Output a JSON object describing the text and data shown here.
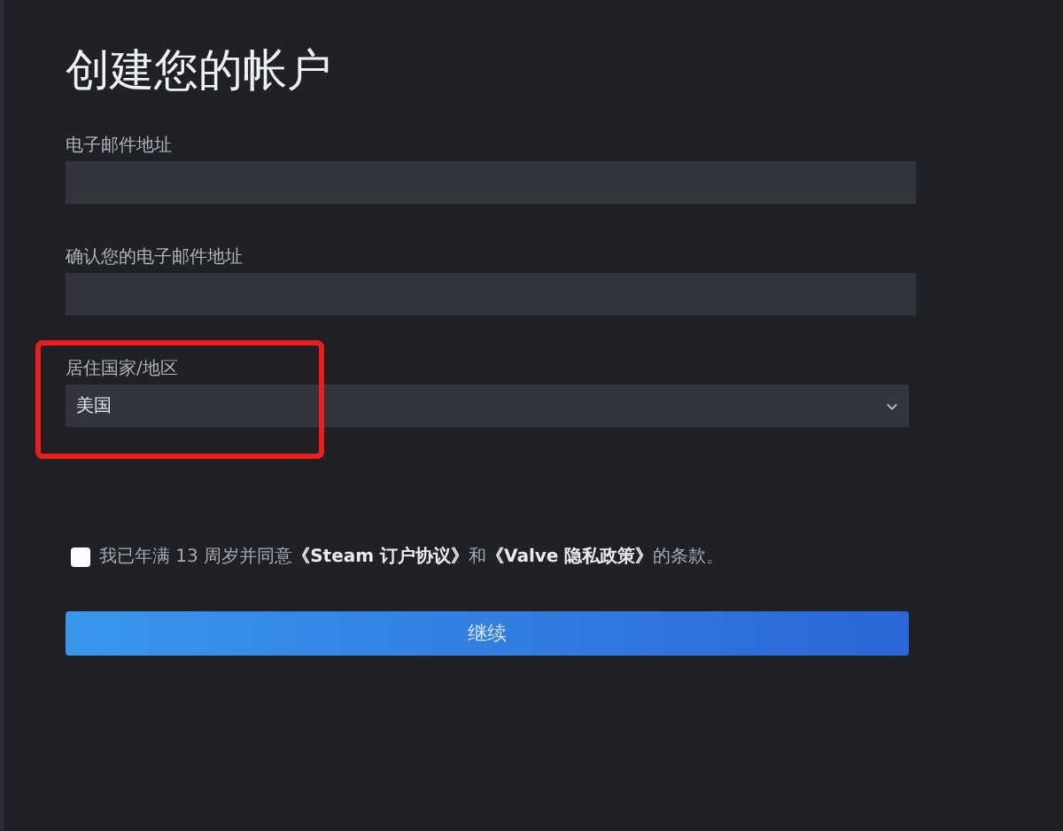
{
  "title": "创建您的帐户",
  "fields": [
    {
      "kind": "text",
      "label": "电子邮件地址",
      "highlighted": false
    },
    {
      "kind": "text",
      "label": "确认您的电子邮件地址",
      "highlighted": false
    },
    {
      "kind": "select",
      "label": "居住国家/地区",
      "value": "美国",
      "highlighted": true
    }
  ],
  "agreement": {
    "checked": false,
    "before": "我已年满 13 周岁并同意",
    "link_1": "《Steam 订户协议》",
    "middle": "和",
    "link_2": "《Valve 隐私政策》",
    "after": "的条款。"
  },
  "continue_button": "继续"
}
